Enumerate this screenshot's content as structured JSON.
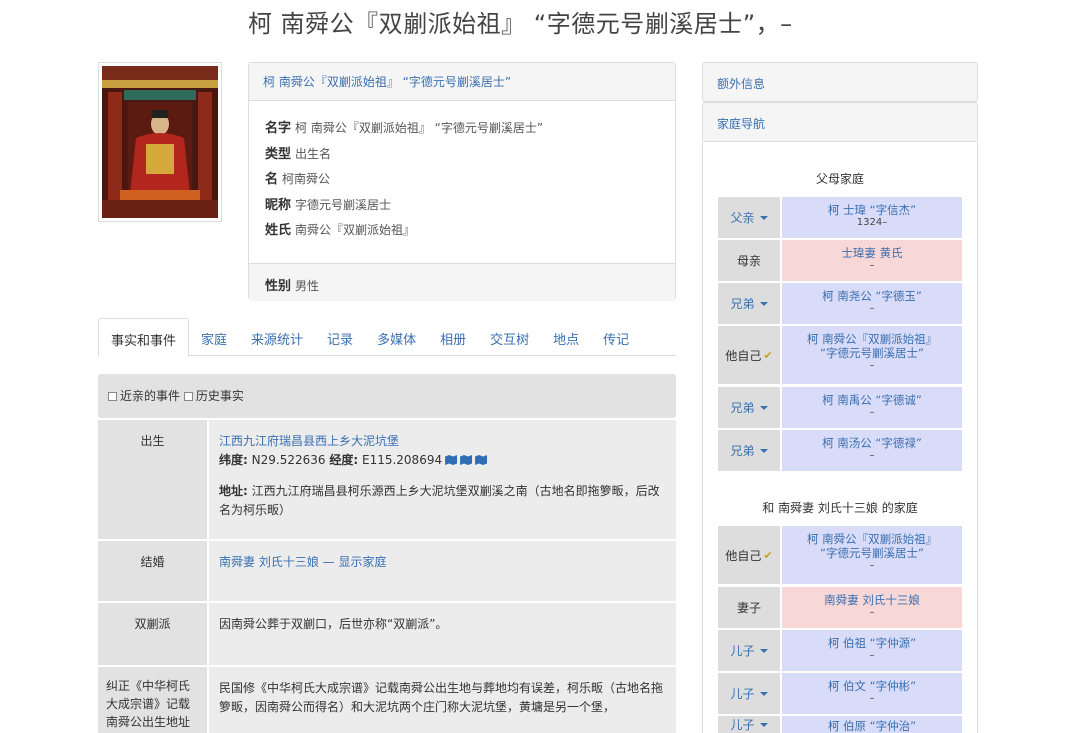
{
  "page_title": "柯 南舜公『双剻派始祖』 “字德元号剻溪居士”，–",
  "name_panel": {
    "header": "柯 南舜公『双剻派始祖』 “字德元号剻溪居士”",
    "rows": [
      {
        "label": "名字",
        "value": "柯 南舜公『双剻派始祖』 “字德元号剻溪居士”"
      },
      {
        "label": "类型",
        "value": "出生名"
      },
      {
        "label": "名",
        "value": "柯南舜公"
      },
      {
        "label": "昵称",
        "value": "字德元号剻溪居士"
      },
      {
        "label": "姓氏",
        "value": "南舜公『双剻派始祖』"
      }
    ],
    "gender_label": "性别",
    "gender_value": "男性"
  },
  "tabs": [
    "事实和事件",
    "家庭",
    "来源统计",
    "记录",
    "多媒体",
    "相册",
    "交互树",
    "地点",
    "传记"
  ],
  "filters": {
    "relatives": "近亲的事件",
    "history": "历史事实"
  },
  "facts": {
    "birth": {
      "label": "出生",
      "place": "江西九江府瑞昌县西上乡大泥坑堡",
      "lat_label": "纬度:",
      "lat": "N29.522636",
      "lon_label": "经度:",
      "lon": "E115.208694",
      "addr_label": "地址:",
      "addr": "江西九江府瑞昌县柯乐源西上乡大泥坑堡双剻溪之南（古地名即拖箩畈，后改名为柯乐畈）"
    },
    "marriage": {
      "label": "结婚",
      "spouse": "南舜妻 刘氏十三娘",
      "dash": "—",
      "show_family": "显示家庭"
    },
    "shuangkuai": {
      "label": "双剻派",
      "text": "因南舜公葬于双剻口，后世亦称“双剻派”。"
    },
    "correction": {
      "label": "纠正《中华柯氏大成宗谱》记载南舜公出生地址",
      "text": "民国修《中华柯氏大成宗谱》记载南舜公出生地与葬地均有误差，柯乐畈（古地名拖箩畈，因南舜公而得名）和大泥坑两个庄门称大泥坑堡，黄墉是另一个堡，"
    }
  },
  "side": {
    "extra_info": "额外信息",
    "family_nav": "家庭导航"
  },
  "parents_family": {
    "heading": "父母家庭",
    "rows": [
      {
        "rel": "父亲",
        "name": "柯 士瑋 “字信杰”",
        "sub": "1324–",
        "gender": "male",
        "dropdown": true
      },
      {
        "rel": "母亲",
        "name": "士瑋妻 黄氏",
        "sub": "–",
        "gender": "female",
        "dropdown": false
      },
      {
        "rel": "兄弟",
        "name": "柯 南尧公 “字德玉”",
        "sub": "–",
        "gender": "male",
        "dropdown": true
      },
      {
        "rel": "他自己",
        "name": "柯 南舜公『双剻派始祖』",
        "name2": "“字德元号剻溪居士”",
        "sub": "–",
        "gender": "male",
        "self": true
      },
      {
        "rel": "兄弟",
        "name": "柯 南禹公 “字德诚”",
        "sub": "–",
        "gender": "male",
        "dropdown": true
      },
      {
        "rel": "兄弟",
        "name": "柯 南汤公 “字德禄”",
        "sub": "–",
        "gender": "male",
        "dropdown": true
      }
    ]
  },
  "own_family": {
    "heading": "和 南舜妻 刘氏十三娘 的家庭",
    "rows": [
      {
        "rel": "他自己",
        "name": "柯 南舜公『双剻派始祖』",
        "name2": "“字德元号剻溪居士”",
        "sub": "–",
        "gender": "male",
        "self": true
      },
      {
        "rel": "妻子",
        "name": "南舜妻 刘氏十三娘",
        "sub": "–",
        "gender": "female",
        "dropdown": false
      },
      {
        "rel": "儿子",
        "name": "柯 伯祖 “字仲源”",
        "sub": "–",
        "gender": "male",
        "dropdown": true
      },
      {
        "rel": "儿子",
        "name": "柯 伯文 “字仲彬”",
        "sub": "–",
        "gender": "male",
        "dropdown": true
      },
      {
        "rel": "儿子",
        "name": "柯 伯原 “字仲治”",
        "sub": "–",
        "gender": "male",
        "dropdown": true
      }
    ]
  },
  "colors": {
    "link": "#3a6fb0",
    "male_bg": "#d9dcf8",
    "female_bg": "#f8d7d7",
    "panel_bg": "#f5f5f5",
    "fact_bg": "#ececec"
  }
}
